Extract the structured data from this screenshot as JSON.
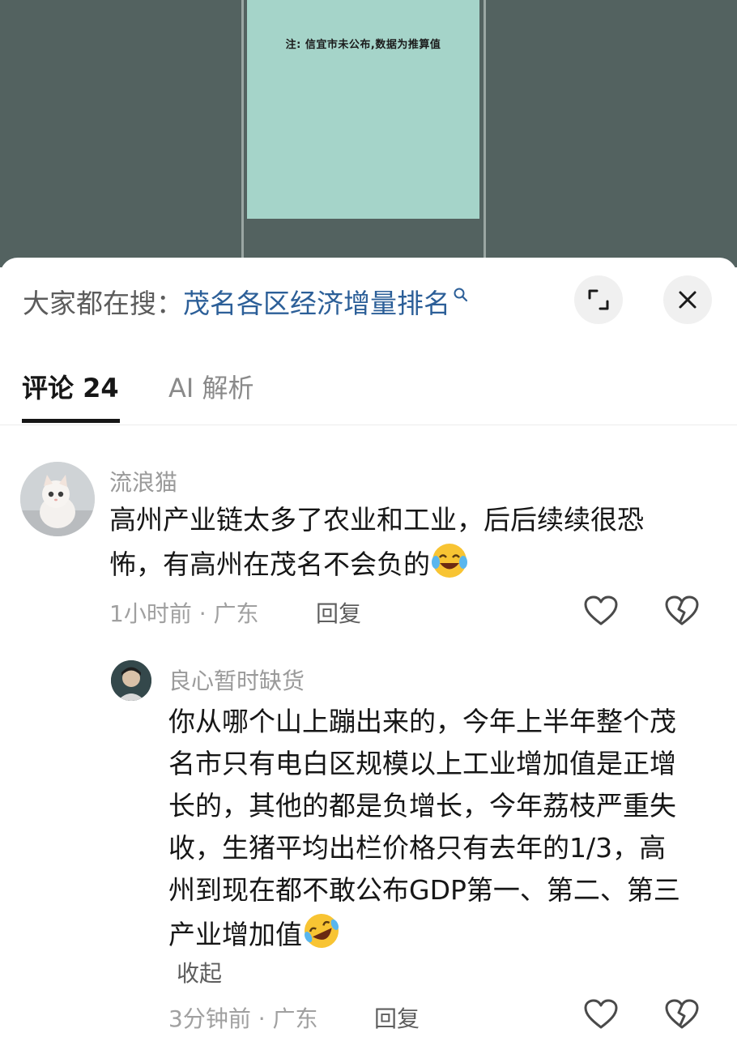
{
  "media": {
    "note": "注: 信宜市未公布,数据为推算值"
  },
  "search": {
    "prefix": "大家都在搜：",
    "query": "茂名各区经济增量排名",
    "icon": "search-icon"
  },
  "header_buttons": {
    "expand_icon": "expand-icon",
    "close_icon": "close-icon"
  },
  "tabs": [
    {
      "label": "评论 24",
      "active": true
    },
    {
      "label": "AI 解析",
      "active": false
    }
  ],
  "comments": [
    {
      "username": "流浪猫",
      "text": "高州产业链太多了农业和工业，后后续续很恐怖，有高州在茂名不会负的",
      "emoji": "crying-laughing-emoji",
      "time_location": "1小时前 · 广东",
      "reply_label": "回复",
      "replies": [
        {
          "username": "良心暂时缺货",
          "text": "你从哪个山上蹦出来的，今年上半年整个茂名市只有电白区规模以上工业增加值是正增长的，其他的都是负增长，今年荔枝严重失收，生猪平均出栏价格只有去年的1/3，高州到现在都不敢公布GDP第一、第二、第三产业增加值",
          "emoji": "rolling-laughing-emoji",
          "collapse_label": "收起",
          "time_location": "3分钟前 · 广东",
          "reply_label": "回复"
        }
      ]
    }
  ],
  "colors": {
    "link": "#2c5f98",
    "media_bg": "#536260",
    "panel": "#a5d4c9"
  }
}
